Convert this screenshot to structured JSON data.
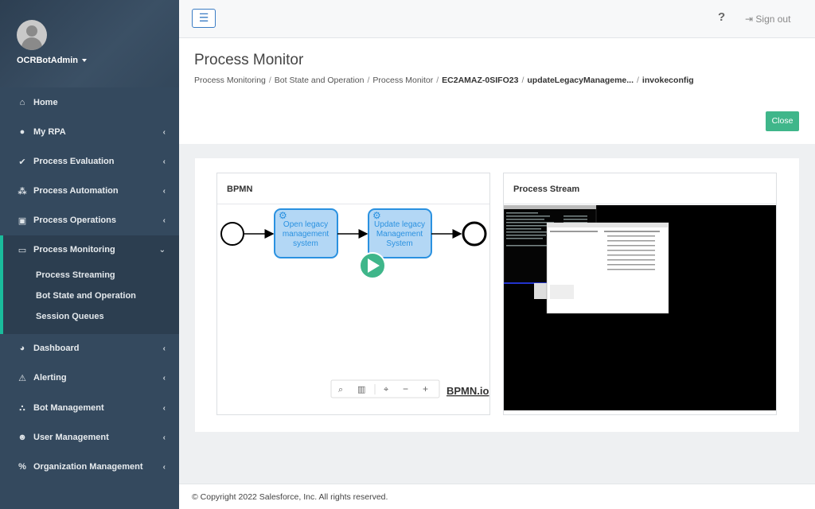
{
  "sidebar": {
    "username": "OCRBotAdmin",
    "items": [
      {
        "label": "Home",
        "icon": "home-icon"
      },
      {
        "label": "My RPA",
        "icon": "user-icon"
      },
      {
        "label": "Process Evaluation",
        "icon": "check-icon"
      },
      {
        "label": "Process Automation",
        "icon": "sitemap-icon"
      },
      {
        "label": "Process Operations",
        "icon": "operations-icon"
      },
      {
        "label": "Process Monitoring",
        "icon": "monitor-icon"
      },
      {
        "label": "Dashboard",
        "icon": "pie-chart-icon"
      },
      {
        "label": "Alerting",
        "icon": "warning-icon"
      },
      {
        "label": "Bot Management",
        "icon": "bot-icon"
      },
      {
        "label": "User Management",
        "icon": "users-icon"
      },
      {
        "label": "Organization Management",
        "icon": "org-icon"
      }
    ],
    "sub_items": [
      "Process Streaming",
      "Bot State and Operation",
      "Session Queues"
    ]
  },
  "header": {
    "menu_icon": "hamburger-icon",
    "help": "?",
    "signout": "Sign out"
  },
  "page": {
    "title": "Process Monitor",
    "breadcrumbs": [
      "Process Monitoring",
      "Bot State and Operation",
      "Process Monitor",
      "EC2AMAZ-0SIFO23",
      "updateLegacyManageme...",
      "invokeconfig"
    ],
    "close_label": "Close"
  },
  "bpmn": {
    "title": "BPMN",
    "task1": [
      "Open legacy",
      "management",
      "system"
    ],
    "task2": [
      "Update legacy",
      "Management",
      "System"
    ],
    "logo": "BPMN.io"
  },
  "stream": {
    "title": "Process Stream"
  },
  "footer": {
    "copyright": "© Copyright 2022 Salesforce, Inc. All rights reserved."
  }
}
